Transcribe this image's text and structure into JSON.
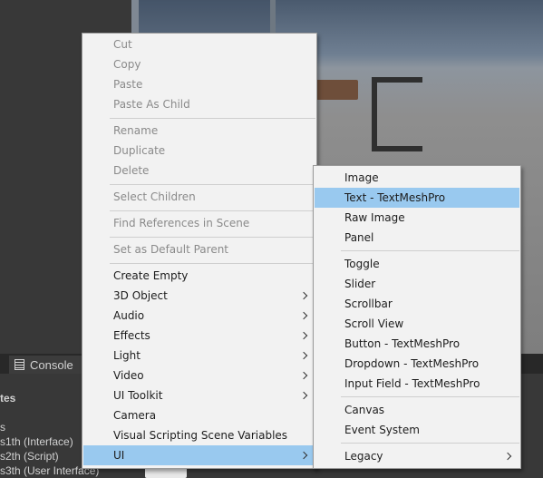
{
  "console_tab": "Console",
  "inspector": {
    "header": "tes",
    "section": "s",
    "rows": [
      "s1th (Interface)",
      "s2th (Script)",
      "s3th (User Interface)"
    ]
  },
  "context_menu": {
    "items": [
      {
        "label": "Cut",
        "disabled": true
      },
      {
        "label": "Copy",
        "disabled": true
      },
      {
        "label": "Paste",
        "disabled": true
      },
      {
        "label": "Paste As Child",
        "disabled": true
      },
      {
        "label": "Rename",
        "disabled": true
      },
      {
        "label": "Duplicate",
        "disabled": true
      },
      {
        "label": "Delete",
        "disabled": true
      },
      {
        "label": "Select Children",
        "disabled": true
      },
      {
        "label": "Find References in Scene",
        "disabled": true
      },
      {
        "label": "Set as Default Parent",
        "disabled": true
      },
      {
        "label": "Create Empty"
      },
      {
        "label": "3D Object",
        "submenu": true
      },
      {
        "label": "Audio",
        "submenu": true
      },
      {
        "label": "Effects",
        "submenu": true
      },
      {
        "label": "Light",
        "submenu": true
      },
      {
        "label": "Video",
        "submenu": true
      },
      {
        "label": "UI Toolkit",
        "submenu": true
      },
      {
        "label": "Camera"
      },
      {
        "label": "Visual Scripting Scene Variables"
      },
      {
        "label": "UI",
        "submenu": true,
        "selected": true
      }
    ]
  },
  "ui_submenu": {
    "items": [
      {
        "label": "Image"
      },
      {
        "label": "Text - TextMeshPro",
        "hover": true
      },
      {
        "label": "Raw Image"
      },
      {
        "label": "Panel"
      },
      {
        "label": "Toggle"
      },
      {
        "label": "Slider"
      },
      {
        "label": "Scrollbar"
      },
      {
        "label": "Scroll View"
      },
      {
        "label": "Button - TextMeshPro"
      },
      {
        "label": "Dropdown - TextMeshPro"
      },
      {
        "label": "Input Field - TextMeshPro"
      },
      {
        "label": "Canvas"
      },
      {
        "label": "Event System"
      },
      {
        "label": "Legacy",
        "submenu": true
      }
    ]
  },
  "colors": {
    "menu_bg": "#f2f2f2",
    "highlight": "#99c9ef",
    "disabled_text": "#8a8a8a",
    "editor_bg": "#383838"
  }
}
